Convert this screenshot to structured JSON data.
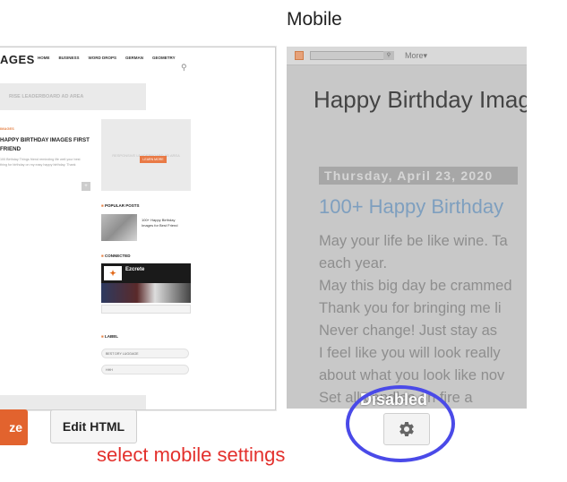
{
  "desktop": {
    "logo": "AGES",
    "nav": [
      "HOME",
      "BUSINESS",
      "WORD DROPS",
      "GERMAN",
      "GEOMETRY"
    ],
    "leaderboard_ad": "RISE LEADERBOARD AD AREA",
    "post_label": "IMAGES",
    "post_title": "HAPPY BIRTHDAY IMAGES FIRST FRIEND",
    "post_excerpt": "100 Birthday Things friend reminding life well your best thing for birthday on my easy happy birthday. Thank",
    "sidebar_ad": "RESPONSIVE LEADERBOARD AD AREA",
    "read_more": "LEARN MORE",
    "popular_posts_title": "POPULAR POSTS",
    "popular_post_text": "100+ Happy Birthday Images for Best Friend",
    "connected_title": "CONNECTED",
    "fb_page_name": "Ezcrete",
    "label_title": "LABEL",
    "label_select_1": "BEST DRY LUGGAGE",
    "label_select_2": "HHH"
  },
  "mobile": {
    "heading": "Mobile",
    "more_label": "More",
    "blog_title": "Happy Birthday Imag",
    "post_date": "Thursday, April 23, 2020",
    "post_title": "100+ Happy Birthday",
    "body_lines": [
      "May your life be like wine. Ta",
      "each year.",
      "May this big day be crammed",
      "Thank you for bringing me li",
      "Never change! Just stay as",
      "I feel like you will look really",
      "about what you look like nov",
      "Set all candles on fire a"
    ],
    "disabled_overlay": "Disabled"
  },
  "buttons": {
    "customize": "ze",
    "edit_html": "Edit HTML",
    "mobile_settings_icon": "gear-icon"
  },
  "annotation": {
    "text": "select mobile settings",
    "color": "#e3302c",
    "circle_color": "#4a4ae8"
  }
}
